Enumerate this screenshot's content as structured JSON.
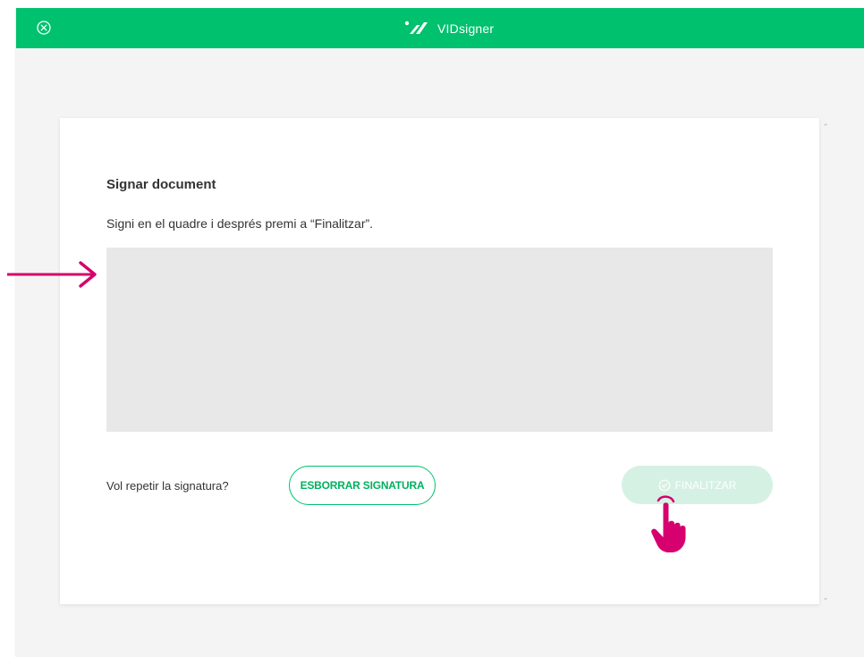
{
  "header": {
    "brand_name": "VIDsigner",
    "close_icon": "close-circle-icon",
    "logo_icon": "vidsigner-logo-icon",
    "bar_color": "#00c16e"
  },
  "dialog": {
    "title": "Signar document",
    "instructions": "Signi en el quadre i després premi a “Finalitzar”.",
    "repeat_question": "Vol repetir la signatura?",
    "clear_button_label": "ESBORRAR SIGNATURA",
    "finish_button_label": "FINALITZAR",
    "finish_button_state": "disabled",
    "finish_icon": "check-circle-icon"
  },
  "annotations": {
    "arrow_icon": "arrow-right-icon",
    "hand_icon": "pointing-hand-icon",
    "annotation_color": "#d6006e"
  }
}
